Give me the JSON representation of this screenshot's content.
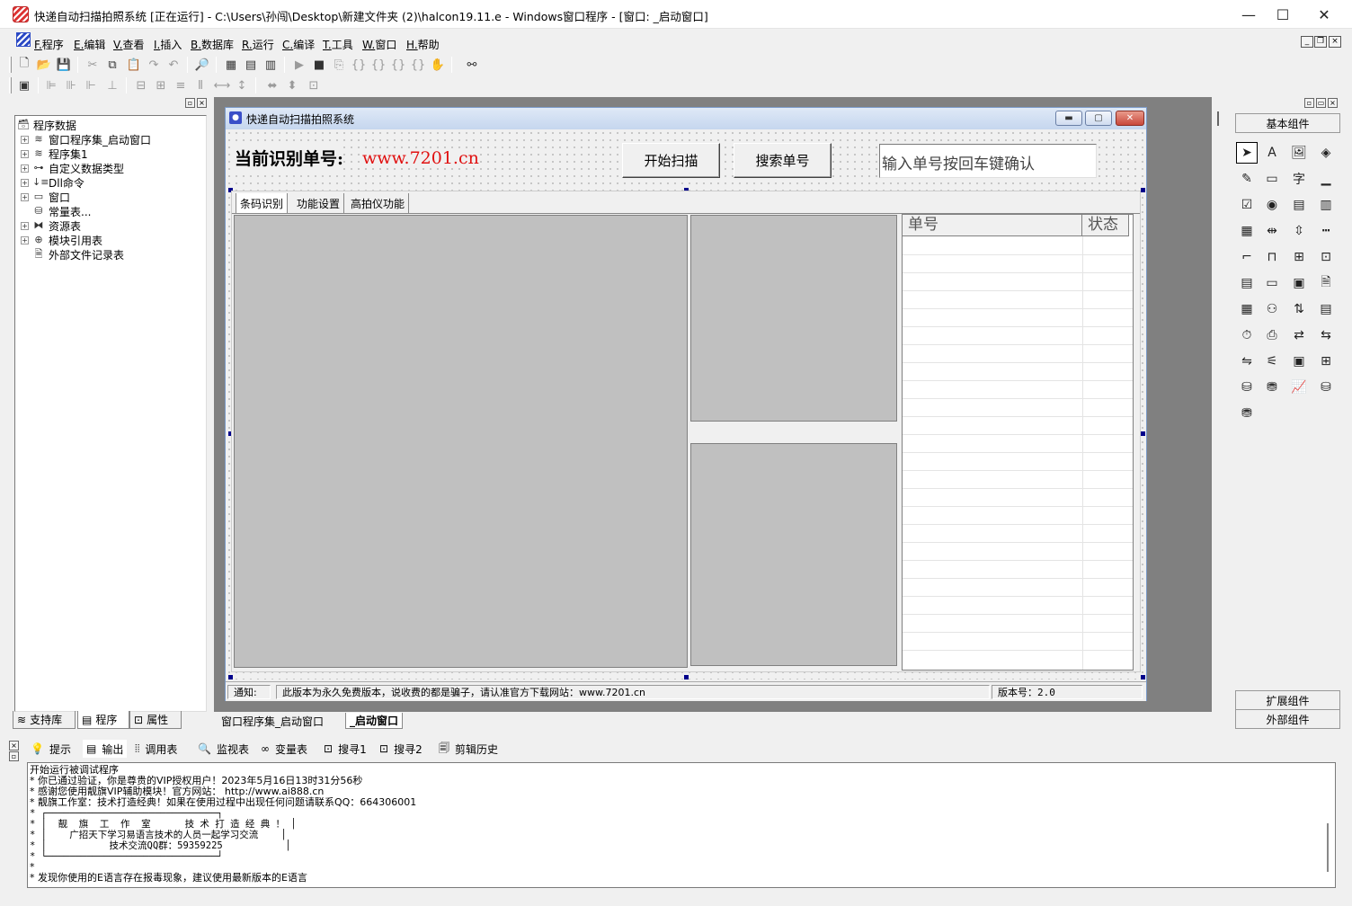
{
  "window": {
    "title": "快递自动扫描拍照系统 [正在运行] - C:\\Users\\孙闯\\Desktop\\新建文件夹 (2)\\halcon19.11.e - Windows窗口程序 - [窗口: _启动窗口]",
    "minimize": "—",
    "maximize": "☐",
    "close": "✕"
  },
  "menu": [
    {
      "key": "F.",
      "label": "程序"
    },
    {
      "key": "E.",
      "label": "编辑"
    },
    {
      "key": "V.",
      "label": "查看"
    },
    {
      "key": "I.",
      "label": "插入"
    },
    {
      "key": "B.",
      "label": "数据库"
    },
    {
      "key": "R.",
      "label": "运行"
    },
    {
      "key": "C.",
      "label": "编译"
    },
    {
      "key": "T.",
      "label": "工具"
    },
    {
      "key": "W.",
      "label": "窗口"
    },
    {
      "key": "H.",
      "label": "帮助"
    }
  ],
  "tree": {
    "root": "程序数据",
    "items": [
      {
        "label": "窗口程序集_启动窗口",
        "icon": "stack-icon"
      },
      {
        "label": "程序集1",
        "icon": "stack-icon"
      },
      {
        "label": "自定义数据类型",
        "icon": "type-icon"
      },
      {
        "label": "Dll命令",
        "icon": "dll-icon"
      },
      {
        "label": "窗口",
        "icon": "window-icon"
      },
      {
        "label": "常量表...",
        "icon": "const-icon"
      },
      {
        "label": "资源表",
        "icon": "resource-icon"
      },
      {
        "label": "模块引用表",
        "icon": "module-icon"
      },
      {
        "label": "外部文件记录表",
        "icon": "file-icon"
      }
    ]
  },
  "left_tabs": [
    "支持库",
    "程序",
    "属性"
  ],
  "form": {
    "title": "快递自动扫描拍照系统",
    "current_label": "当前识别单号:",
    "current_value": "www.7201.cn",
    "scan_button": "开始扫描",
    "search_button": "搜索单号",
    "input_value": "输入单号按回车键确认",
    "tabs": [
      "条码识别",
      "功能设置",
      "高拍仪功能"
    ],
    "list_columns": [
      "单号",
      "状态"
    ],
    "status_notice_label": "通知:",
    "status_notice": "此版本为永久免费版本，说收费的都是骗子，请认准官方下载网站：www.7201.cn",
    "status_version": "版本号：2.0"
  },
  "palette": {
    "basic": "基本组件",
    "extended": "扩展组件",
    "external": "外部组件"
  },
  "design_tabs": [
    "窗口程序集_启动窗口",
    "_启动窗口"
  ],
  "output_tabs": [
    "提示",
    "输出",
    "调用表",
    "监视表",
    "变量表",
    "搜寻1",
    "搜寻2",
    "剪辑历史"
  ],
  "output_lines": [
    "开始运行被调试程序",
    "* 你已通过验证，你是尊贵的VIP授权用户！2023年5月16日13时31分56秒",
    "* 感谢您使用靓旗VIP辅助模块！官方网站： http://www.ai888.cn",
    "* 靓旗工作室：技术打造经典！如果在使用过程中出现任何问题请联系QQ：664306001",
    "* ┌──────────────────────────────┐",
    "* │  靓  旗  工  作  室      技 术 打 造 经 典 ！ │",
    "* │    广招天下学习易语言技术的人员一起学习交流    │",
    "* │           技术交流QQ群：59359225           │",
    "* └──────────────────────────────┘",
    "*",
    "* 发现你使用的E语言存在报毒现象，建议使用最新版本的E语言"
  ]
}
